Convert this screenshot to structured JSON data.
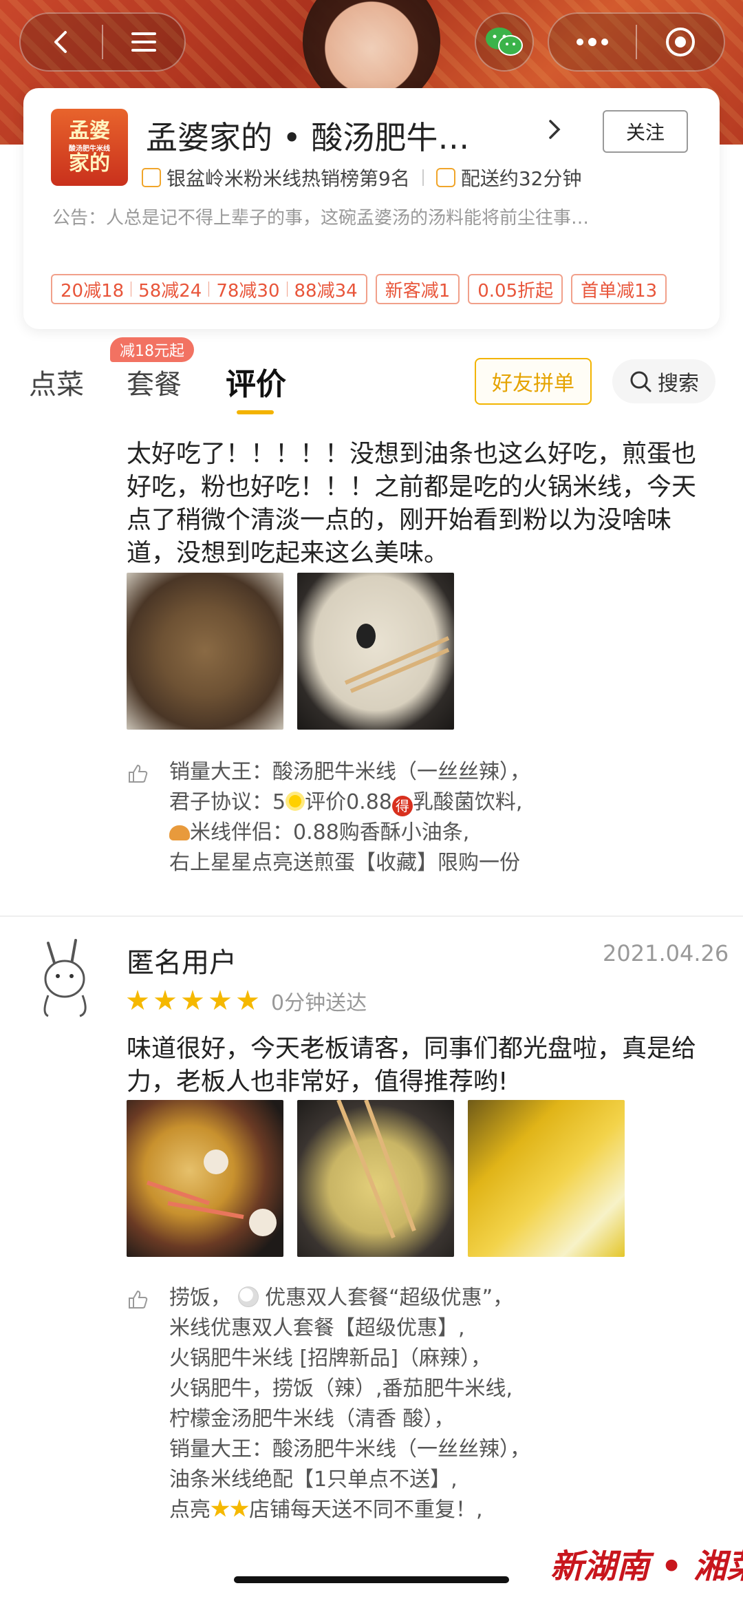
{
  "store": {
    "name": "孟婆家的 • 酸汤肥牛…",
    "logo_line1": "孟婆",
    "logo_line2": "酸汤肥牛米线",
    "logo_line3": "家的",
    "follow_label": "关注",
    "rank": "银盆岭米粉米线热销榜第9名",
    "delivery_time": "配送约32分钟",
    "notice": "公告：人总是记不得上辈子的事，这碗孟婆汤的汤料能将前尘往事…",
    "promos": {
      "group": [
        "20减18",
        "58减24",
        "78减30",
        "88减34"
      ],
      "new_customer": "新客减1",
      "discount": "0.05折起",
      "first_order": "首单减13"
    }
  },
  "tabs": {
    "dishes": "点菜",
    "sets": "套餐",
    "reviews": "评价",
    "set_badge": "减18元起",
    "friends_order": "好友拼单",
    "search": "搜索"
  },
  "review1": {
    "text": "太好吃了！！！！！没想到油条也这么好吃，煎蛋也好吃，粉也好吃！！！之前都是吃的火锅米线，今天点了稍微个清淡一点的，刚开始看到粉以为没啥味道，没想到吃起来这么美味。",
    "tags": {
      "l1": "销量大王：酸汤肥牛米线（一丝丝辣），",
      "l2a": "君子协议：5",
      "l2b": "评价0.88",
      "l2c": "乳酸菌饮料,",
      "l3": "米线伴侣：0.88购香酥小油条,",
      "l4": "右上星星点亮送煎蛋【收藏】限购一份"
    }
  },
  "review2": {
    "user": "匿名用户",
    "date": "2021.04.26",
    "rating": 5,
    "delivery": "0分钟送达",
    "text": "味道很好，今天老板请客，同事们都光盘啦，真是给力，老板人也非常好，值得推荐哟!",
    "tags": {
      "l1a": "捞饭，",
      "l1b": "优惠双人套餐“超级优惠”，",
      "l2": "米线优惠双人套餐【超级优惠】,",
      "l3": "火锅肥牛米线 [招牌新品]（麻辣），",
      "l4": "火锅肥牛，捞饭（辣）,番茄肥牛米线,",
      "l5": "柠檬金汤肥牛米线（清香 酸），",
      "l6": "销量大王：酸汤肥牛米线（一丝丝辣），",
      "l7": "油条米线绝配【1只单点不送】,",
      "l8a": "点亮",
      "l8b": "店铺每天送不同不重复！,"
    }
  },
  "watermark": "新湖南 • 湘菜",
  "colors": {
    "accent_yellow": "#f3b300",
    "promo_red": "#e8553a",
    "star": "#f5b800"
  }
}
